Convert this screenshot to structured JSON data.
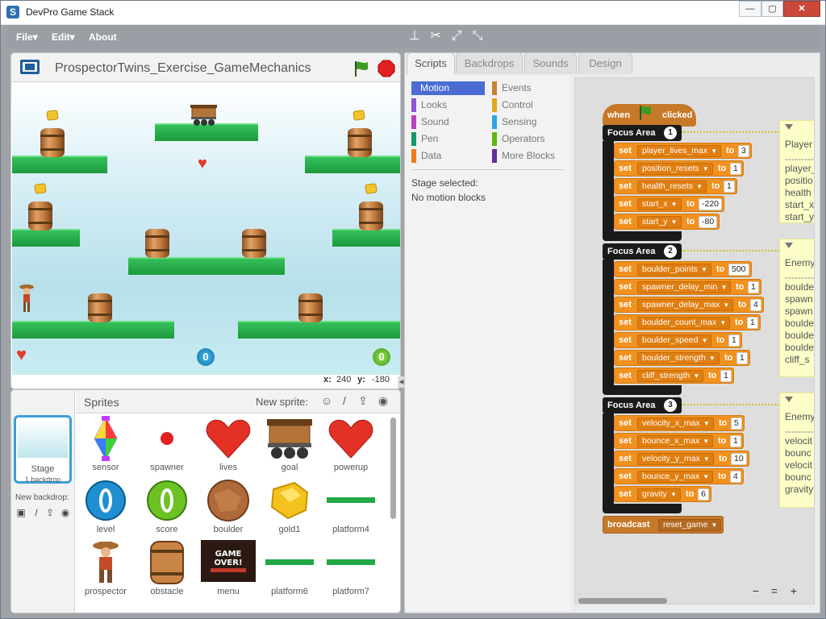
{
  "window": {
    "title": "DevPro Game Stack",
    "app_icon_letter": "S",
    "minimize": "—",
    "restore": "▢",
    "close": "✕"
  },
  "menu": {
    "file": "File",
    "edit": "Edit",
    "about": "About",
    "dropdown_glyph": "▾"
  },
  "toolbar": {
    "icons": [
      "stamp-icon",
      "scissors-icon",
      "grow-icon",
      "shrink-icon"
    ],
    "glyphs": [
      "⊥",
      "✂",
      "⤢",
      "⤡"
    ]
  },
  "stage": {
    "project_title": "ProspectorTwins_Exercise_GameMechanics",
    "score_coin": "0",
    "level_coin": "0",
    "x_label": "x:",
    "x_value": "240",
    "y_label": "y:",
    "y_value": "-180"
  },
  "sprites_panel": {
    "title": "Sprites",
    "new_sprite_label": "New sprite:",
    "stage_thumb_label": "Stage",
    "stage_thumb_sub": "1 backdrop",
    "new_backdrop_label": "New backdrop:",
    "sprites": [
      {
        "name": "sensor"
      },
      {
        "name": "spawner"
      },
      {
        "name": "lives"
      },
      {
        "name": "goal"
      },
      {
        "name": "powerup"
      },
      {
        "name": "level"
      },
      {
        "name": "score"
      },
      {
        "name": "boulder"
      },
      {
        "name": "gold1"
      },
      {
        "name": "platform4"
      },
      {
        "name": "prospector"
      },
      {
        "name": "obstacle"
      },
      {
        "name": "menu"
      },
      {
        "name": "platform6"
      },
      {
        "name": "platform7"
      }
    ],
    "menu_thumb_text1": "GAME",
    "menu_thumb_text2": "OVER!"
  },
  "tabs": [
    {
      "label": "Scripts"
    },
    {
      "label": "Backdrops"
    },
    {
      "label": "Sounds"
    },
    {
      "label": "Design"
    }
  ],
  "palette": {
    "categories": [
      {
        "label": "Motion",
        "color": "#4a6cd4"
      },
      {
        "label": "Looks",
        "color": "#8a55d7"
      },
      {
        "label": "Sound",
        "color": "#bb42c3"
      },
      {
        "label": "Pen",
        "color": "#0e9a6c"
      },
      {
        "label": "Data",
        "color": "#ee7d16"
      },
      {
        "label": "Events",
        "color": "#c88330"
      },
      {
        "label": "Control",
        "color": "#e1a91a"
      },
      {
        "label": "Sensing",
        "color": "#2ca5e2"
      },
      {
        "label": "Operators",
        "color": "#5cb712"
      },
      {
        "label": "More Blocks",
        "color": "#632d99"
      }
    ],
    "stage_selected": "Stage selected:",
    "no_motion": "No motion blocks"
  },
  "script": {
    "hat_when": "when",
    "hat_clicked": "clicked",
    "set_word": "set",
    "to_word": "to",
    "focus_word": "Focus Area",
    "areas": [
      {
        "num": "1",
        "note_title": "Player",
        "note_lines": [
          "player_",
          "positio",
          "health",
          "start_x",
          "start_y"
        ],
        "sets": [
          {
            "var": "player_lives_max",
            "val": "3"
          },
          {
            "var": "position_resets",
            "val": "1"
          },
          {
            "var": "health_resets",
            "val": "1"
          },
          {
            "var": "start_x",
            "val": "-220"
          },
          {
            "var": "start_y",
            "val": "-80"
          }
        ]
      },
      {
        "num": "2",
        "note_title": "Enemy",
        "note_lines": [
          "boulde",
          "spawn",
          "spawn",
          "boulde",
          "boulde",
          "boulde",
          "cliff_s"
        ],
        "sets": [
          {
            "var": "boulder_points",
            "val": "500"
          },
          {
            "var": "spawner_delay_min",
            "val": "1"
          },
          {
            "var": "spawner_delay_max",
            "val": "4"
          },
          {
            "var": "boulder_count_max",
            "val": "1"
          },
          {
            "var": "boulder_speed",
            "val": "1"
          },
          {
            "var": "boulder_strength",
            "val": "1"
          },
          {
            "var": "cliff_strength",
            "val": "1"
          }
        ]
      },
      {
        "num": "3",
        "note_title": "Enemy",
        "note_lines": [
          "velocit",
          "bounc",
          "velocit",
          "bounc",
          "gravity"
        ],
        "sets": [
          {
            "var": "velocity_x_max",
            "val": "5"
          },
          {
            "var": "bounce_x_max",
            "val": "1"
          },
          {
            "var": "velocity_y_max",
            "val": "10"
          },
          {
            "var": "bounce_y_max",
            "val": "4"
          },
          {
            "var": "gravity",
            "val": "6"
          }
        ]
      }
    ],
    "note_separator": "----------",
    "broadcast_label": "broadcast",
    "broadcast_value": "reset_game",
    "zoom_out": "−",
    "zoom_reset": "=",
    "zoom_in": "+"
  }
}
